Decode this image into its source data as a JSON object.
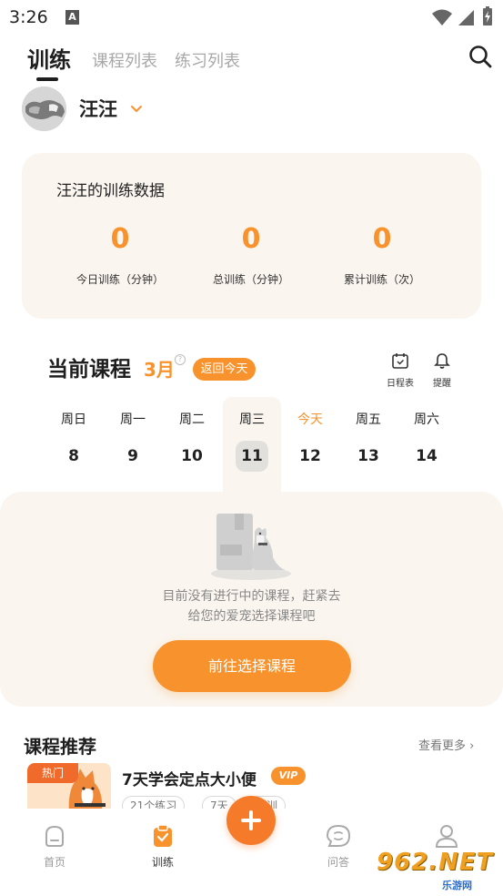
{
  "status_bar": {
    "time": "3:26",
    "a_label": "A"
  },
  "tabs": [
    {
      "label": "训练"
    },
    {
      "label": "课程列表"
    },
    {
      "label": "练习列表"
    }
  ],
  "pet": {
    "name": "汪汪"
  },
  "stats": {
    "title": "汪汪的训练数据",
    "items": [
      {
        "value": "0",
        "label": "今日训练（分钟）"
      },
      {
        "value": "0",
        "label": "总训练（分钟）"
      },
      {
        "value": "0",
        "label": "累计训练（次）"
      }
    ]
  },
  "current_course": {
    "title": "当前课程",
    "month": "3月",
    "today_button": "返回今天",
    "schedule_label": "日程表",
    "remind_label": "提醒"
  },
  "week": [
    {
      "weekday": "周日",
      "date": "8"
    },
    {
      "weekday": "周一",
      "date": "9"
    },
    {
      "weekday": "周二",
      "date": "10"
    },
    {
      "weekday": "周三",
      "date": "11"
    },
    {
      "weekday": "今天",
      "date": "12"
    },
    {
      "weekday": "周五",
      "date": "13"
    },
    {
      "weekday": "周六",
      "date": "14"
    }
  ],
  "empty": {
    "line1": "目前没有进行中的课程，赶紧去",
    "line2": "给您的爱宠选择课程吧",
    "button": "前往选择课程"
  },
  "recommend": {
    "title": "课程推荐",
    "more": "查看更多",
    "card": {
      "badge": "热门",
      "name": "7天学会定点大小便",
      "vip": "VIP",
      "tags": [
        "21个练习",
        "7天",
        "…训"
      ]
    }
  },
  "bottom_nav": [
    {
      "label": "首页"
    },
    {
      "label": "训练"
    },
    {
      "label": "问答"
    },
    {
      "label": "我的"
    }
  ],
  "watermark": {
    "main": "962.NET",
    "sub": "乐游网"
  },
  "colors": {
    "accent": "#f7922c",
    "card_bg": "#faf5ee"
  }
}
